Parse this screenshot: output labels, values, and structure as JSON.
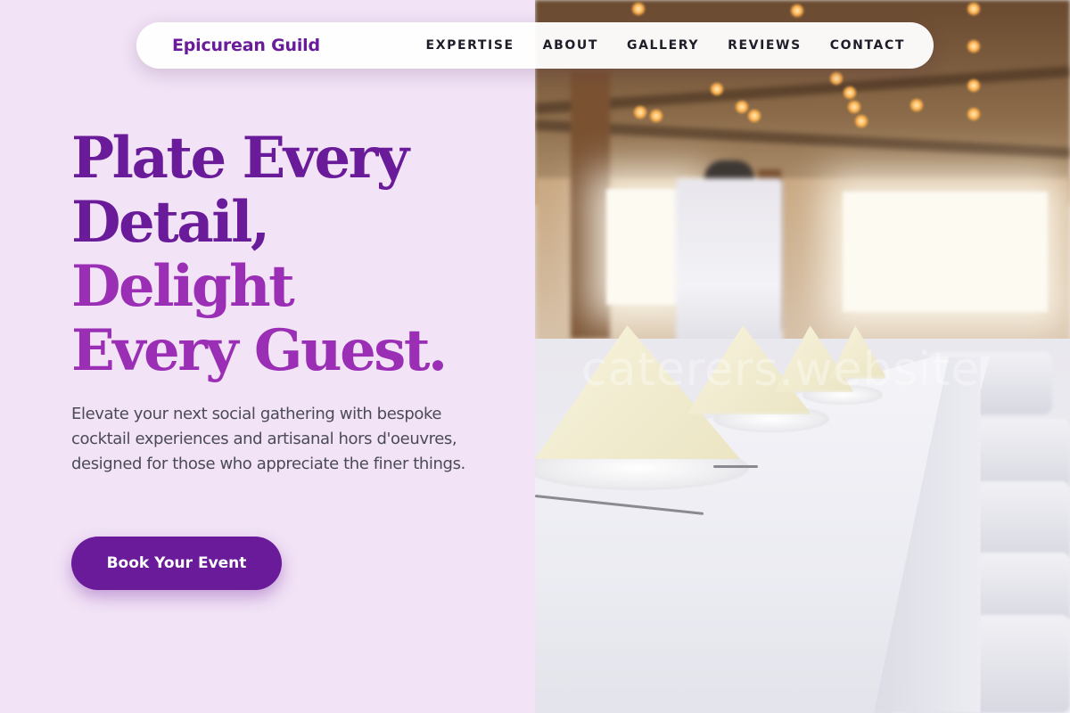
{
  "nav": {
    "brand": "Epicurean Guild",
    "links": [
      "EXPERTISE",
      "ABOUT",
      "GALLERY",
      "REVIEWS",
      "CONTACT"
    ]
  },
  "hero": {
    "headline_lines": [
      "Plate Every",
      "Detail,",
      "Delight",
      "Every Guest."
    ],
    "subtext": "Elevate your next social gathering with bespoke cocktail experiences and artisanal hors d'oeuvres, designed for those who appreciate the finer things.",
    "cta_label": "Book Your Event"
  },
  "photo": {
    "watermark": "caterers.website"
  },
  "colors": {
    "primary": "#6a1b9a",
    "accent": "#9a2eb5",
    "panel_background": "#f2e3f6"
  }
}
